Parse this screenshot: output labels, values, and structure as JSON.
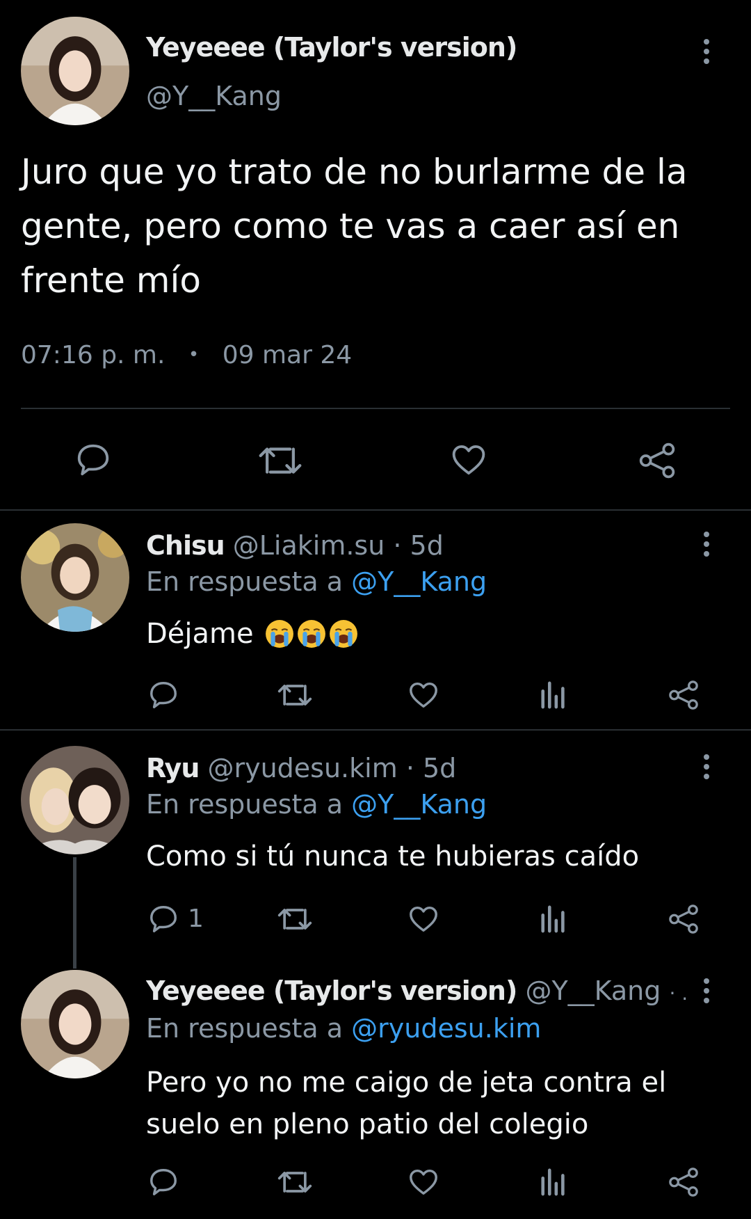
{
  "main_tweet": {
    "display_name": "Yeyeeee (Taylor's version)",
    "handle": "@Y__Kang",
    "text": "Juro que yo trato de no burlarme de la gente, pero como te vas a caer así en frente mío",
    "time": "07:16 p. m.",
    "separator": "•",
    "date": "09 mar 24"
  },
  "replies": [
    {
      "display_name": "Chisu",
      "handle": "@Liakim.su",
      "age": "· 5d",
      "reply_prefix": "En respuesta a",
      "reply_to": "@Y__Kang",
      "text": "Déjame",
      "emoji": [
        "loudly-crying-face",
        "loudly-crying-face",
        "loudly-crying-face"
      ],
      "reply_count": ""
    },
    {
      "display_name": "Ryu",
      "handle": "@ryudesu.kim",
      "age": "· 5d",
      "reply_prefix": "En respuesta a",
      "reply_to": "@Y__Kang",
      "text": "Como si tú nunca te hubieras caído",
      "reply_count": "1"
    },
    {
      "display_name": "Yeyeeee (Taylor's version)",
      "handle": "@Y__Kang",
      "age": "· ...",
      "reply_prefix": "En respuesta a",
      "reply_to": "@ryudesu.kim",
      "text": "Pero yo no me caigo de jeta contra el suelo en pleno patio del colegio",
      "reply_count": ""
    }
  ],
  "icons": {
    "reply": "reply-bubble-icon",
    "retweet": "retweet-icon",
    "like": "heart-icon",
    "views": "views-bar-chart-icon",
    "share": "share-icon",
    "more": "more-vertical-icon"
  },
  "colors": {
    "background": "#000000",
    "text": "#e7e9ea",
    "muted": "#8b98a5",
    "link": "#3ca0f0",
    "divider": "#2a2f33"
  }
}
